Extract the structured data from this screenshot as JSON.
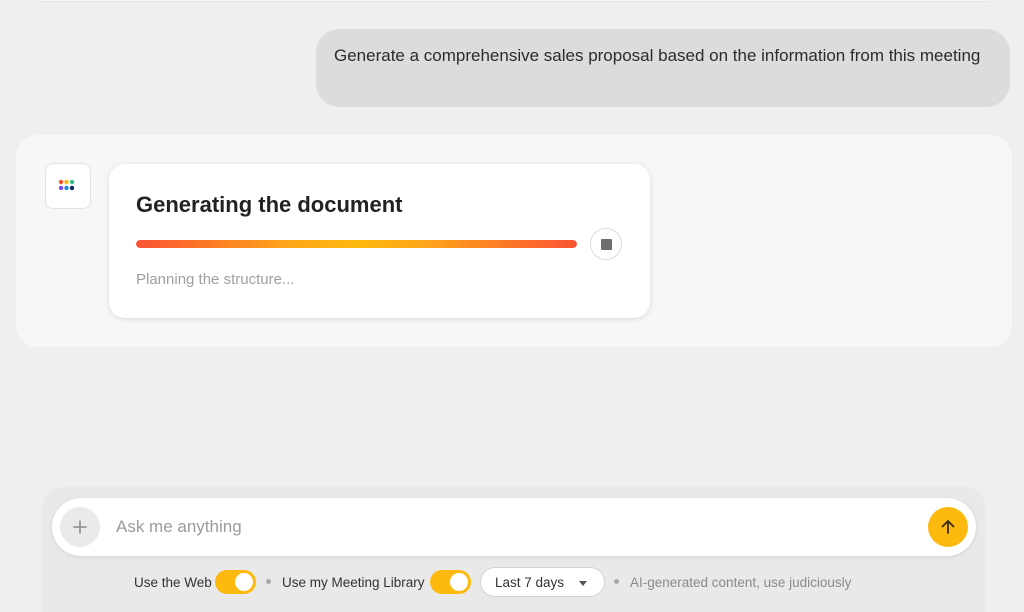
{
  "conversation": {
    "user_message": "Generate a comprehensive sales proposal based on the information from this meeting"
  },
  "assistant": {
    "avatar_icon": "app-logo-icon",
    "card": {
      "title": "Generating the document",
      "status": "Planning the structure...",
      "progress_percent": 100,
      "stop_icon": "stop-icon"
    }
  },
  "composer": {
    "placeholder": "Ask me anything",
    "add_icon": "plus-icon",
    "send_icon": "arrow-up-icon",
    "options": {
      "use_web_label": "Use the Web",
      "use_web_enabled": true,
      "meeting_library_label": "Use my Meeting Library",
      "meeting_library_enabled": true,
      "time_range": "Last 7 days",
      "disclaimer": "AI-generated content, use judiciously"
    }
  },
  "colors": {
    "accent": "#fdb90e",
    "progress_start": "#fb5332",
    "progress_mid": "#fdb90e"
  }
}
